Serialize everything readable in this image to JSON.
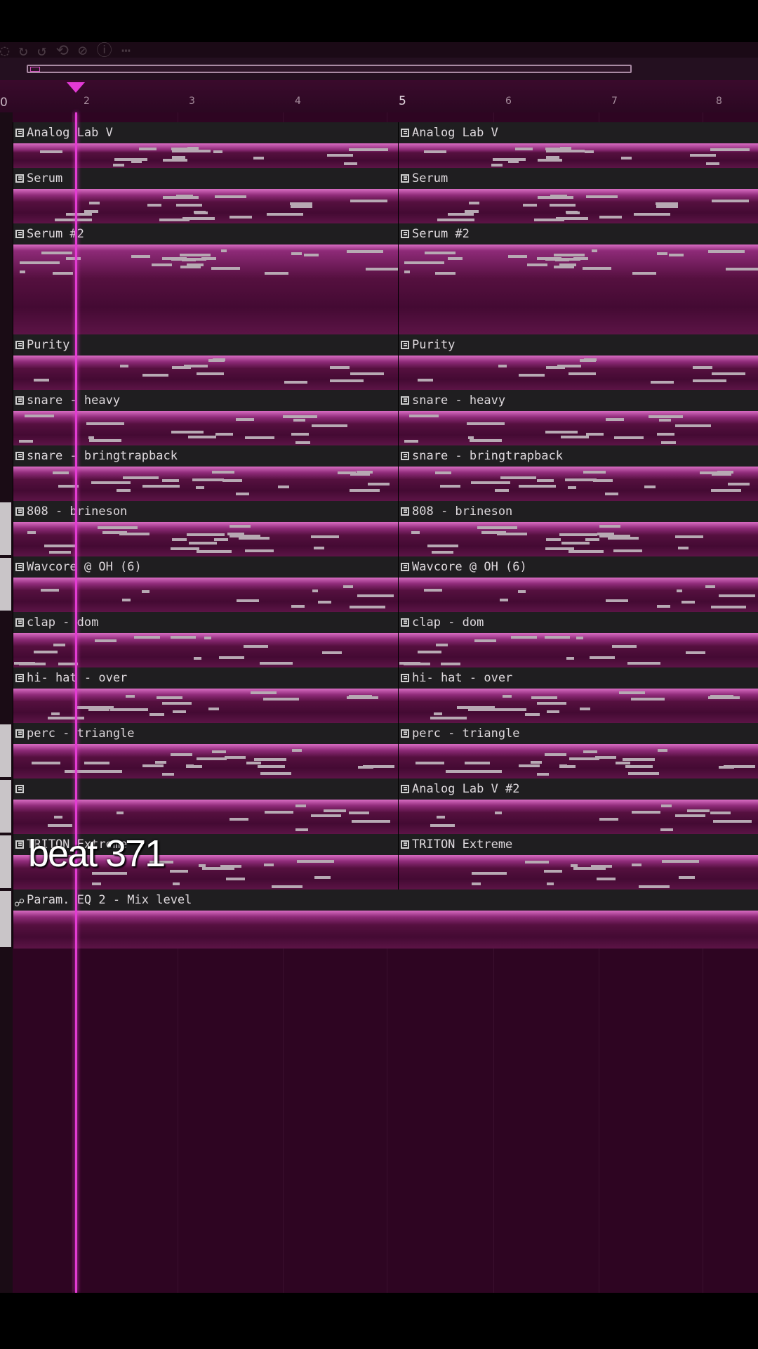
{
  "top_bar": {
    "ghost_text": "◌ ↻ ↺  ⟲  ⊘  ⓘ  ⋯"
  },
  "ruler": {
    "zero_label": "0",
    "ticks": [
      {
        "label": "2",
        "major": false
      },
      {
        "label": "3",
        "major": false
      },
      {
        "label": "4",
        "major": false
      },
      {
        "label": "5",
        "major": true
      },
      {
        "label": "6",
        "major": false
      },
      {
        "label": "7",
        "major": false
      },
      {
        "label": "8",
        "major": false
      }
    ]
  },
  "tracks": [
    {
      "name": "Analog Lab V",
      "icon": "piano-roll-icon"
    },
    {
      "name": "Serum",
      "icon": "piano-roll-icon"
    },
    {
      "name": "Serum #2",
      "icon": "piano-roll-icon"
    },
    {
      "name": "Purity",
      "icon": "piano-roll-icon"
    },
    {
      "name": "snare - heavy",
      "icon": "piano-roll-icon"
    },
    {
      "name": "snare - bringtrapback",
      "icon": "piano-roll-icon"
    },
    {
      "name": "808 - brineson",
      "icon": "piano-roll-icon"
    },
    {
      "name": "Wavcore @ OH (6)",
      "icon": "piano-roll-icon"
    },
    {
      "name": "clap - dom",
      "icon": "piano-roll-icon"
    },
    {
      "name": "hi- hat - over",
      "icon": "piano-roll-icon"
    },
    {
      "name": "perc - triangle",
      "icon": "piano-roll-icon"
    },
    {
      "name": "Analog Lab V #2",
      "icon": "piano-roll-icon",
      "left_label_hidden": true
    },
    {
      "name": "TRITON Extreme",
      "icon": "piano-roll-icon"
    },
    {
      "name": "Param. EQ 2 - Mix level",
      "icon": "automation-icon",
      "full_width": true
    }
  ],
  "caption": "beat 371",
  "colors": {
    "accent": "#e33bd2",
    "clip_top": "#d86cc2",
    "clip_body": "#4a0b37",
    "header_bg": "#1f1e20",
    "background": "#2e0522"
  }
}
